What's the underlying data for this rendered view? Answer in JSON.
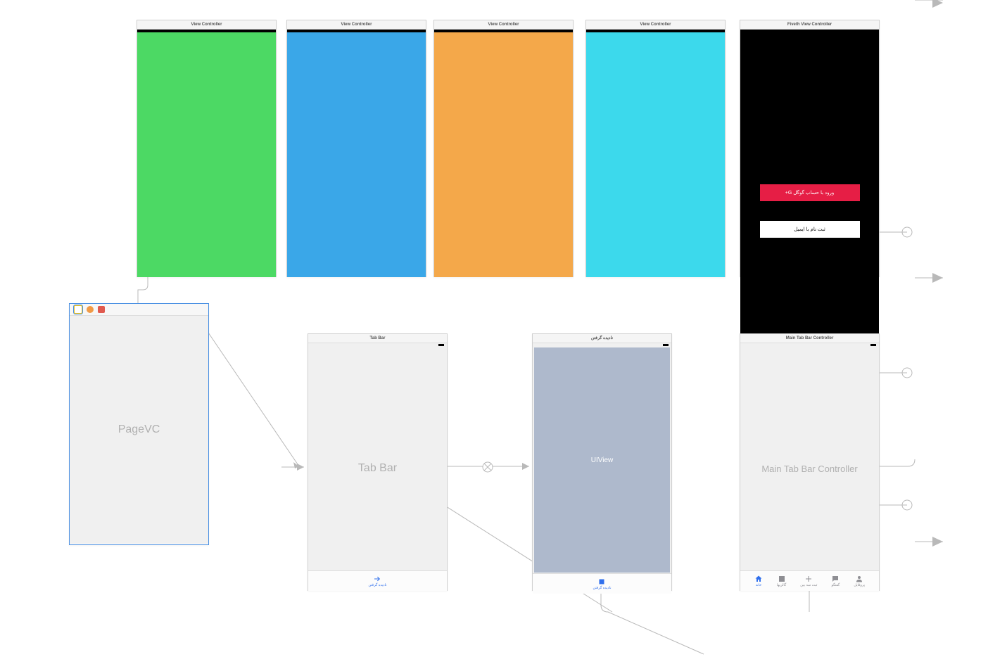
{
  "topScenes": [
    {
      "title": "View Controller"
    },
    {
      "title": "View Controller"
    },
    {
      "title": "View Controller"
    },
    {
      "title": "View Controller"
    },
    {
      "title": "Fiveth View Controller"
    }
  ],
  "fifth": {
    "googleLogin": "ورود با حساب گوگل  G+",
    "emailSignup": "ثبت نام با ایمیل"
  },
  "pagevc": {
    "label": "PageVC"
  },
  "tabbarScene": {
    "title": "Tab Bar",
    "placeholder": "Tab Bar",
    "tablabel": "نادیده گرفتن"
  },
  "uiviewScene": {
    "title": "نادیده گرفتن",
    "viewLabel": "UIView",
    "tablabel": "نادیده گرفتن"
  },
  "mainTab": {
    "title": "Main Tab Bar Controller",
    "placeholder": "Main Tab Bar Controller",
    "items": [
      {
        "label": "خانه",
        "icon": "home",
        "active": true
      },
      {
        "label": "گالریها",
        "icon": "gallery",
        "active": false
      },
      {
        "label": "ثبت سه بین",
        "icon": "plus",
        "active": false
      },
      {
        "label": "گفتگو",
        "icon": "chat",
        "active": false
      },
      {
        "label": "پروفایل",
        "icon": "profile",
        "active": false
      }
    ]
  }
}
